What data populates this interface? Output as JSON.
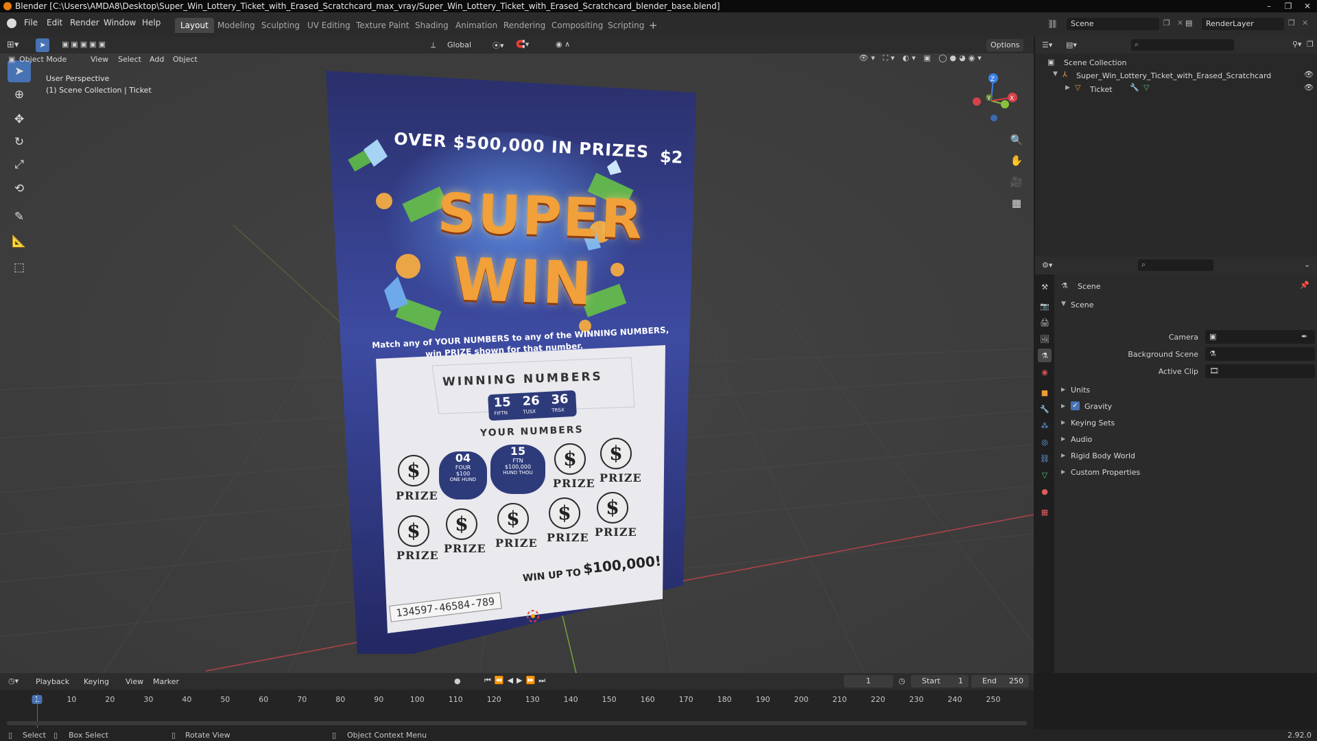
{
  "title_bar": {
    "text": "Blender [C:\\Users\\AMDA8\\Desktop\\Super_Win_Lottery_Ticket_with_Erased_Scratchcard_max_vray/Super_Win_Lottery_Ticket_with_Erased_Scratchcard_blender_base.blend]"
  },
  "menu": {
    "items": [
      "File",
      "Edit",
      "Render",
      "Window",
      "Help"
    ]
  },
  "workspaces": [
    "Layout",
    "Modeling",
    "Sculpting",
    "UV Editing",
    "Texture Paint",
    "Shading",
    "Animation",
    "Rendering",
    "Compositing",
    "Scripting"
  ],
  "scene_selector": {
    "value": "Scene"
  },
  "view_layer_selector": {
    "value": "RenderLayer"
  },
  "viewport_header": {
    "transform_orientation": "Global",
    "options_label": "Options"
  },
  "viewport_header2": {
    "mode": "Object Mode",
    "menus": [
      "View",
      "Select",
      "Add",
      "Object"
    ]
  },
  "viewport_overlay": {
    "line1": "User Perspective",
    "line2": "(1) Scene Collection | Ticket"
  },
  "gizmo": {
    "z": "Z",
    "y": "Y",
    "x": "X"
  },
  "ticket": {
    "headline": "OVER $500,000 IN PRIZES",
    "price": "$2",
    "brand_line1": "SUPER",
    "brand_line2": "WIN",
    "instructions_line1": "Match any of YOUR NUMBERS to any of the WINNING NUMBERS,",
    "instructions_line2": "win PRIZE shown for that number.",
    "winning_title": "WINNING NUMBERS",
    "winning_numbers": [
      "15",
      "26",
      "36"
    ],
    "winning_words": [
      "FIFTN",
      "TUSX",
      "TRSX"
    ],
    "your_numbers_title": "YOUR NUMBERS",
    "symbol": "$",
    "prize_label": "PRIZE",
    "scratched1": {
      "num": "04",
      "l1": "FOUR",
      "l2": "$100",
      "l3": "ONE HUND"
    },
    "scratched2": {
      "num": "15",
      "l1": "FTN",
      "l2": "$100,000",
      "l3": "HUND THOU"
    },
    "win_up_to": "WIN UP TO",
    "win_amount": "$100,000!",
    "serial": "134597-46584-789"
  },
  "outliner": {
    "root": "Scene Collection",
    "items": [
      {
        "label": "Super_Win_Lottery_Ticket_with_Erased_Scratchcard"
      },
      {
        "label": "Ticket"
      }
    ]
  },
  "properties": {
    "header": "Scene",
    "section": "Scene",
    "fields": [
      {
        "label": "Camera"
      },
      {
        "label": "Background Scene"
      },
      {
        "label": "Active Clip"
      }
    ],
    "subpanels": [
      "Units",
      "Gravity",
      "Keying Sets",
      "Audio",
      "Rigid Body World",
      "Custom Properties"
    ],
    "gravity_checked": true
  },
  "timeline": {
    "menus": [
      "Playback",
      "Keying",
      "View",
      "Marker"
    ],
    "current_frame": "1",
    "start_label": "Start",
    "start_value": "1",
    "end_label": "End",
    "end_value": "250",
    "ticks": [
      "1",
      "10",
      "20",
      "30",
      "40",
      "50",
      "60",
      "70",
      "80",
      "90",
      "100",
      "110",
      "120",
      "130",
      "140",
      "150",
      "160",
      "170",
      "180",
      "190",
      "200",
      "210",
      "220",
      "230",
      "240",
      "250"
    ]
  },
  "status": {
    "select": "Select",
    "box_select": "Box Select",
    "rotate": "Rotate View",
    "context": "Object Context Menu",
    "version": "2.92.0"
  },
  "colors": {
    "accent": "#4772b3",
    "active_frame": "#4772b3",
    "axis_x": "#d7414a",
    "axis_y": "#8ac13c",
    "axis_z": "#3b82e6"
  }
}
